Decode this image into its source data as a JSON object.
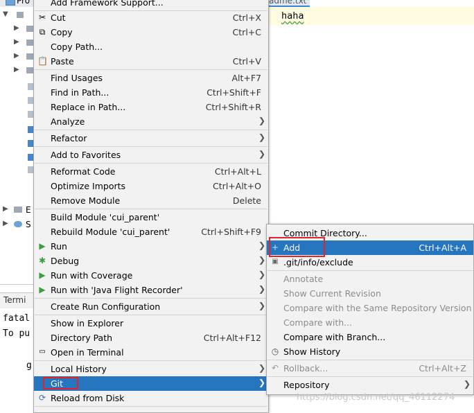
{
  "background": {
    "project_title": "Pro",
    "tree_labels": [
      "E",
      "S"
    ],
    "editor_tab": "adme.txt",
    "editor_text": "haha",
    "terminal_tab": "Termi",
    "terminal_lines": [
      "fatal",
      "To pu",
      "g"
    ]
  },
  "context_menu": {
    "items": [
      {
        "label": "Add Framework Support...",
        "shortcut": ""
      },
      {
        "label": "Cut",
        "shortcut": "Ctrl+X",
        "icon": "scissors-icon"
      },
      {
        "label": "Copy",
        "shortcut": "Ctrl+C",
        "icon": "copy-icon"
      },
      {
        "label": "Copy Path...",
        "shortcut": ""
      },
      {
        "label": "Paste",
        "shortcut": "Ctrl+V",
        "icon": "paste-icon"
      },
      {
        "label": "Find Usages",
        "shortcut": "Alt+F7"
      },
      {
        "label": "Find in Path...",
        "shortcut": "Ctrl+Shift+F"
      },
      {
        "label": "Replace in Path...",
        "shortcut": "Ctrl+Shift+R"
      },
      {
        "label": "Analyze",
        "shortcut": "",
        "submenu": true
      },
      {
        "label": "Refactor",
        "shortcut": "",
        "submenu": true
      },
      {
        "label": "Add to Favorites",
        "shortcut": "",
        "submenu": true
      },
      {
        "label": "Reformat Code",
        "shortcut": "Ctrl+Alt+L"
      },
      {
        "label": "Optimize Imports",
        "shortcut": "Ctrl+Alt+O"
      },
      {
        "label": "Remove Module",
        "shortcut": "Delete"
      },
      {
        "label": "Build Module 'cui_parent'",
        "shortcut": ""
      },
      {
        "label": "Rebuild Module 'cui_parent'",
        "shortcut": "Ctrl+Shift+F9"
      },
      {
        "label": "Run",
        "shortcut": "",
        "submenu": true,
        "icon": "run-icon"
      },
      {
        "label": "Debug",
        "shortcut": "",
        "submenu": true,
        "icon": "debug-icon"
      },
      {
        "label": "Run with Coverage",
        "shortcut": "",
        "submenu": true,
        "icon": "coverage-icon"
      },
      {
        "label": "Run with 'Java Flight Recorder'",
        "shortcut": "",
        "submenu": true,
        "icon": "flight-recorder-icon"
      },
      {
        "label": "Create Run Configuration",
        "shortcut": "",
        "submenu": true
      },
      {
        "label": "Show in Explorer",
        "shortcut": ""
      },
      {
        "label": "Directory Path",
        "shortcut": "Ctrl+Alt+F12"
      },
      {
        "label": "Open in Terminal",
        "shortcut": "",
        "icon": "terminal-icon"
      },
      {
        "label": "Local History",
        "shortcut": "",
        "submenu": true
      },
      {
        "label": "Git",
        "shortcut": "",
        "submenu": true,
        "selected": true
      },
      {
        "label": "Reload from Disk",
        "shortcut": "",
        "icon": "reload-icon"
      }
    ]
  },
  "git_submenu": {
    "items": [
      {
        "label": "Commit Directory...",
        "shortcut": ""
      },
      {
        "label": "Add",
        "shortcut": "Ctrl+Alt+A",
        "selected": true,
        "icon": "plus-icon"
      },
      {
        "label": ".git/info/exclude",
        "shortcut": "",
        "icon": "git-file-icon"
      },
      {
        "label": "Annotate",
        "shortcut": "",
        "disabled": true
      },
      {
        "label": "Show Current Revision",
        "shortcut": "",
        "disabled": true
      },
      {
        "label": "Compare with the Same Repository Version",
        "shortcut": "",
        "disabled": true
      },
      {
        "label": "Compare with...",
        "shortcut": "",
        "disabled": true
      },
      {
        "label": "Compare with Branch...",
        "shortcut": ""
      },
      {
        "label": "Show History",
        "shortcut": "",
        "icon": "history-icon"
      },
      {
        "label": "Rollback...",
        "shortcut": "Ctrl+Alt+Z",
        "disabled": true,
        "icon": "rollback-icon"
      },
      {
        "label": "Repository",
        "shortcut": "",
        "submenu": true
      }
    ]
  },
  "watermark": "https://blog.csdn.net/qq_46112274",
  "colors": {
    "selection": "#2675bf",
    "highlight_box": "#e0242b",
    "menu_bg": "#f2f2f2"
  }
}
